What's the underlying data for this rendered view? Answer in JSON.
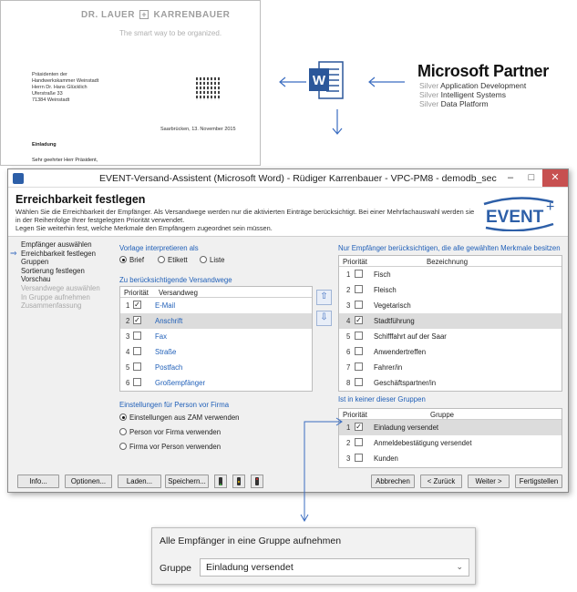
{
  "letter": {
    "logo_left": "DR. LAUER",
    "logo_plus": "+",
    "logo_right": "KARRENBAUER",
    "tagline": "The smart way to be organized.",
    "address": [
      "Präsidenten der",
      "Handwerkskammer Weinstadt",
      "Herrn Dr. Hans Glücklich",
      "Uferstraße 33",
      "71384 Weinstadt"
    ],
    "date": "Saarbrücken, 13. November 2015",
    "subject": "Einladung",
    "salutation": "Sehr geehrter Herr Präsident,"
  },
  "word_icon": {
    "letter": "W",
    "color": "#2b579a"
  },
  "ms_partner": {
    "title": "Microsoft Partner",
    "competencies": [
      {
        "level": "Silver",
        "name": "Application Development"
      },
      {
        "level": "Silver",
        "name": "Intelligent Systems"
      },
      {
        "level": "Silver",
        "name": "Data Platform"
      }
    ]
  },
  "dialog": {
    "window_title": "EVENT-Versand-Assistent (Microsoft Word) - Rüdiger Karrenbauer - VPC-PM8 - demodb_sec",
    "controls": {
      "minimize": "–",
      "maximize": "□",
      "close": "✕"
    },
    "header": {
      "title": "Erreichbarkeit festlegen",
      "description_1": "Wählen Sie die Erreichbarkeit der Empfänger. Als Versandwege werden nur die aktivierten Einträge berücksichtigt. Bei einer Mehrfachauswahl werden sie in der Reihenfolge Ihrer festgelegten Priorität verwendet.",
      "description_2": "Legen Sie weiterhin fest, welche Merkmale den Empfängern zugeordnet sein müssen."
    },
    "event_logo": {
      "text": "EVENT",
      "plus": "+"
    },
    "nav": [
      {
        "label": "Empfänger auswählen",
        "state": "done"
      },
      {
        "label": "Erreichbarkeit festlegen",
        "state": "current"
      },
      {
        "label": "Gruppen",
        "state": "enabled"
      },
      {
        "label": "Sortierung festlegen",
        "state": "enabled"
      },
      {
        "label": "Vorschau",
        "state": "enabled"
      },
      {
        "label": "Versandwege auswählen",
        "state": "disabled"
      },
      {
        "label": "In Gruppe aufnehmen",
        "state": "disabled"
      },
      {
        "label": "Zusammenfassung",
        "state": "disabled"
      }
    ],
    "template": {
      "label": "Vorlage interpretieren als",
      "options": [
        {
          "label": "Brief",
          "selected": true
        },
        {
          "label": "Etikett",
          "selected": false
        },
        {
          "label": "Liste",
          "selected": false
        }
      ]
    },
    "channels": {
      "label": "Zu berücksichtigende Versandwege",
      "col_priority": "Priorität",
      "col_channel": "Versandweg",
      "rows": [
        {
          "prio": "1",
          "checked": true,
          "name": "E-Mail",
          "selected": false
        },
        {
          "prio": "2",
          "checked": true,
          "name": "Anschrift",
          "selected": true
        },
        {
          "prio": "3",
          "checked": false,
          "name": "Fax",
          "selected": false
        },
        {
          "prio": "4",
          "checked": false,
          "name": "Straße",
          "selected": false
        },
        {
          "prio": "5",
          "checked": false,
          "name": "Postfach",
          "selected": false
        },
        {
          "prio": "6",
          "checked": false,
          "name": "Großempfänger",
          "selected": false
        }
      ]
    },
    "person_firm": {
      "label": "Einstellungen für Person vor Firma",
      "options": [
        {
          "label": "Einstellungen aus ZAM verwenden",
          "selected": true
        },
        {
          "label": "Person vor Firma verwenden",
          "selected": false
        },
        {
          "label": "Firma vor Person verwenden",
          "selected": false
        }
      ]
    },
    "features": {
      "label": "Nur Empfänger berücksichtigen, die alle gewählten Merkmale besitzen",
      "col_priority": "Priorität",
      "col_name": "Bezeichnung",
      "rows": [
        {
          "prio": "1",
          "checked": false,
          "name": "Fisch",
          "selected": false
        },
        {
          "prio": "2",
          "checked": false,
          "name": "Fleisch",
          "selected": false
        },
        {
          "prio": "3",
          "checked": false,
          "name": "Vegetarisch",
          "selected": false
        },
        {
          "prio": "4",
          "checked": true,
          "name": "Stadtführung",
          "selected": true
        },
        {
          "prio": "5",
          "checked": false,
          "name": "Schifffahrt auf der Saar",
          "selected": false
        },
        {
          "prio": "6",
          "checked": false,
          "name": "Anwendertreffen",
          "selected": false
        },
        {
          "prio": "7",
          "checked": false,
          "name": "Fahrer/in",
          "selected": false
        },
        {
          "prio": "8",
          "checked": false,
          "name": "Geschäftspartner/in",
          "selected": false
        }
      ]
    },
    "groups": {
      "label": "Ist in keiner dieser Gruppen",
      "col_priority": "Priorität",
      "col_group": "Gruppe",
      "rows": [
        {
          "prio": "1",
          "checked": true,
          "name": "Einladung versendet",
          "selected": true
        },
        {
          "prio": "2",
          "checked": false,
          "name": "Anmeldebestätigung versendet",
          "selected": false
        },
        {
          "prio": "3",
          "checked": false,
          "name": "Kunden",
          "selected": false
        }
      ]
    },
    "buttons": {
      "info": "Info...",
      "options": "Optionen...",
      "load": "Laden...",
      "save": "Speichern...",
      "cancel": "Abbrechen",
      "back": "< Zurück",
      "next": "Weiter >",
      "finish": "Fertigstellen"
    }
  },
  "popup": {
    "title": "Alle Empfänger in eine Gruppe aufnehmen",
    "group_label": "Gruppe",
    "group_value": "Einladung versendet"
  }
}
